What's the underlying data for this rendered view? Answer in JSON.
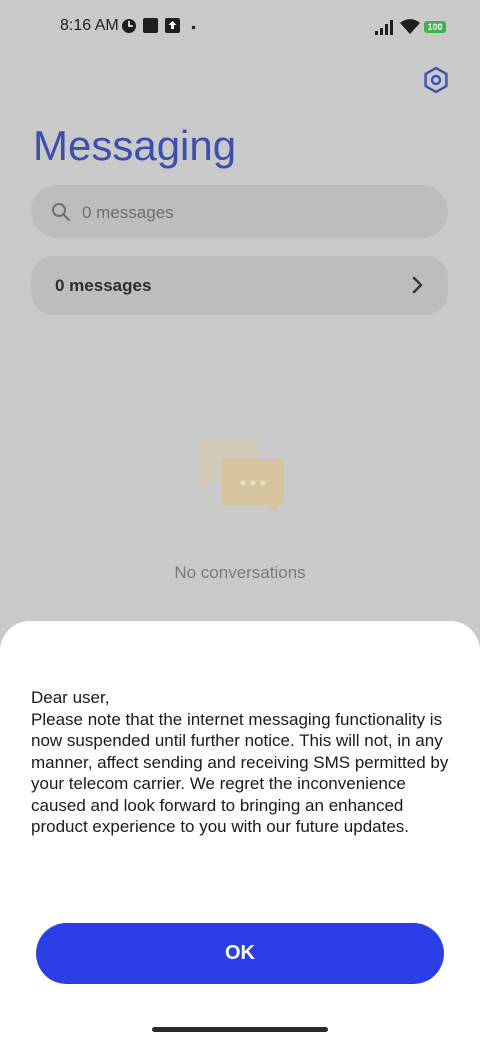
{
  "status_bar": {
    "time": "8:16 AM",
    "battery": "100",
    "icons": [
      "clock-app-icon",
      "square-app-icon",
      "upload-app-icon",
      "dot-icon",
      "signal-icon",
      "wifi-icon",
      "battery-icon"
    ]
  },
  "header": {
    "title": "Messaging",
    "settings_icon": "settings-hex-icon"
  },
  "search": {
    "placeholder": "0 messages",
    "icon": "search-icon"
  },
  "messages_row": {
    "label": "0 messages",
    "icon": "chevron-right-icon"
  },
  "empty_state": {
    "icon": "chat-bubbles-icon",
    "text": "No conversations"
  },
  "dialog": {
    "lines": [
      "Dear user,",
      "Please note that the internet messaging functionality is now suspended until further notice. This will not, in any manner, affect sending and receiving SMS permitted by your telecom carrier. We regret the inconvenience caused and look forward to bringing an enhanced product experience to you with our future updates."
    ],
    "ok_label": "OK"
  },
  "colors": {
    "accent": "#2a3fe6",
    "title": "#3b4fb0",
    "scrim": "#c9c9c9",
    "battery": "#3fb24f"
  }
}
